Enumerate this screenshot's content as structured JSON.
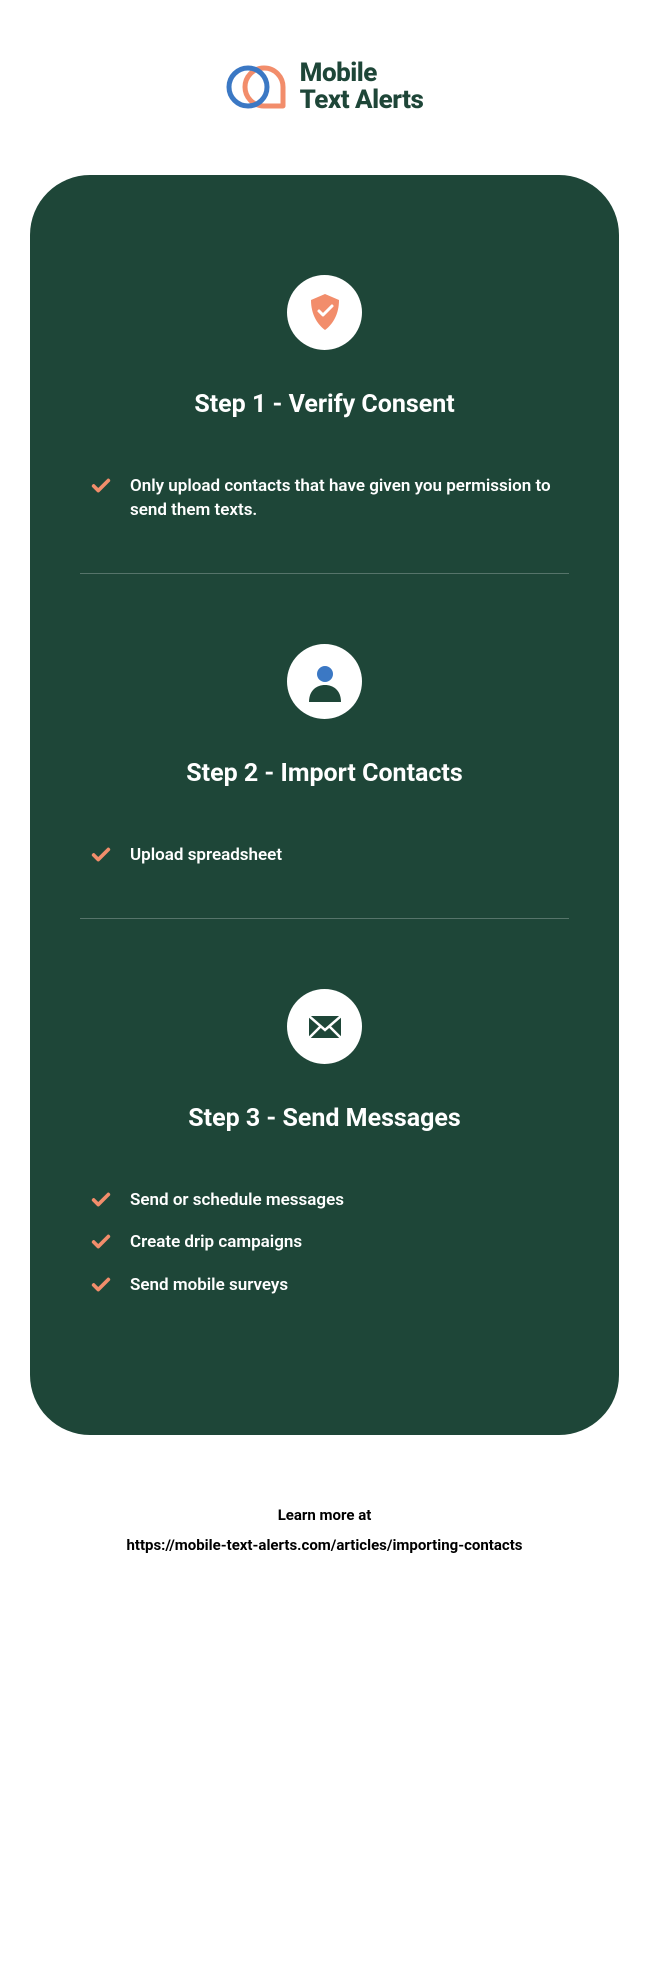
{
  "brand": {
    "line1": "Mobile",
    "line2": "Text Alerts"
  },
  "steps": [
    {
      "title": "Step 1 - Verify Consent",
      "bullets": [
        "Only upload contacts that have given you permission to send them texts."
      ]
    },
    {
      "title": "Step 2 - Import Contacts",
      "bullets": [
        "Upload spreadsheet"
      ]
    },
    {
      "title": "Step 3 - Send Messages",
      "bullets": [
        "Send or schedule messages",
        "Create drip campaigns",
        "Send mobile surveys"
      ]
    }
  ],
  "footer": {
    "line1": "Learn more at",
    "line2": "https://mobile-text-alerts.com/articles/importing-contacts"
  },
  "colors": {
    "cardBg": "#1e4638",
    "accent": "#f28d6b",
    "blue": "#3b78c4"
  }
}
